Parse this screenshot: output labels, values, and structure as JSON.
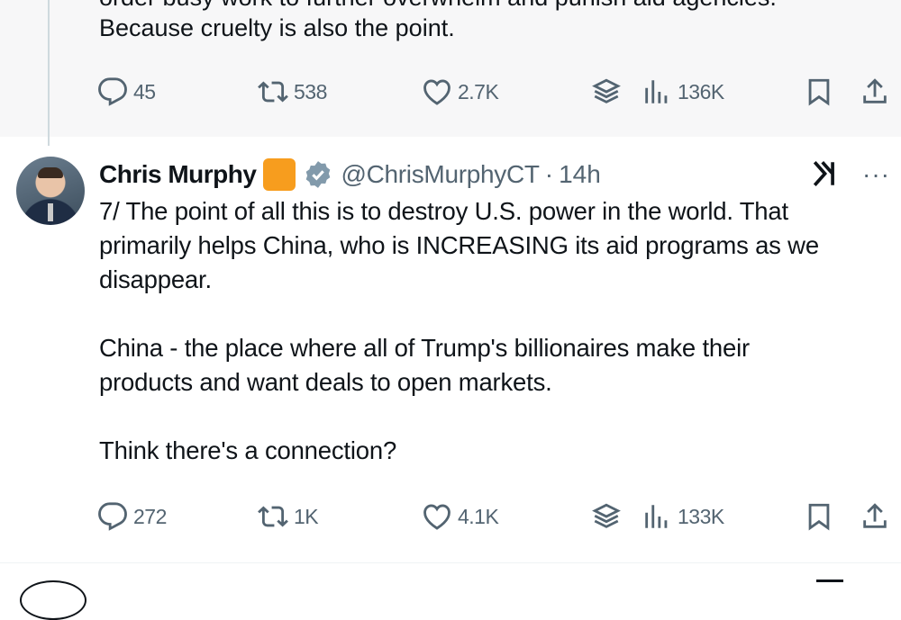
{
  "previous_tweet": {
    "text_cut_line": "order busy work to further overwhelm and punish aid agencies.",
    "text_last_line": "Because cruelty is also the point.",
    "actions": {
      "replies": "45",
      "reposts": "538",
      "likes": "2.7K",
      "views": "136K"
    }
  },
  "tweet": {
    "author_name": "Chris Murphy",
    "handle": "@ChrisMurphyCT",
    "separator": "·",
    "time": "14h",
    "more_label": "···",
    "body": "7/ The point of all this is to destroy U.S. power in the world. That\nprimarily helps China, who is INCREASING its aid programs as we\ndisappear.\n\nChina - the place where all of Trump's billionaires make their\nproducts and want deals to open markets.\n\nThink there's a connection?",
    "actions": {
      "replies": "272",
      "reposts": "1K",
      "likes": "4.1K",
      "views": "133K"
    }
  },
  "colors": {
    "text": "#0f1419",
    "secondary": "#536471",
    "org_badge": "#f79d1e",
    "verified": "#829aab",
    "prev_background": "#f7f7f8"
  },
  "icons": [
    "reply-icon",
    "repost-icon",
    "like-icon",
    "layers-icon",
    "views-icon",
    "bookmark-icon",
    "share-icon",
    "grok-icon",
    "verified-icon"
  ]
}
